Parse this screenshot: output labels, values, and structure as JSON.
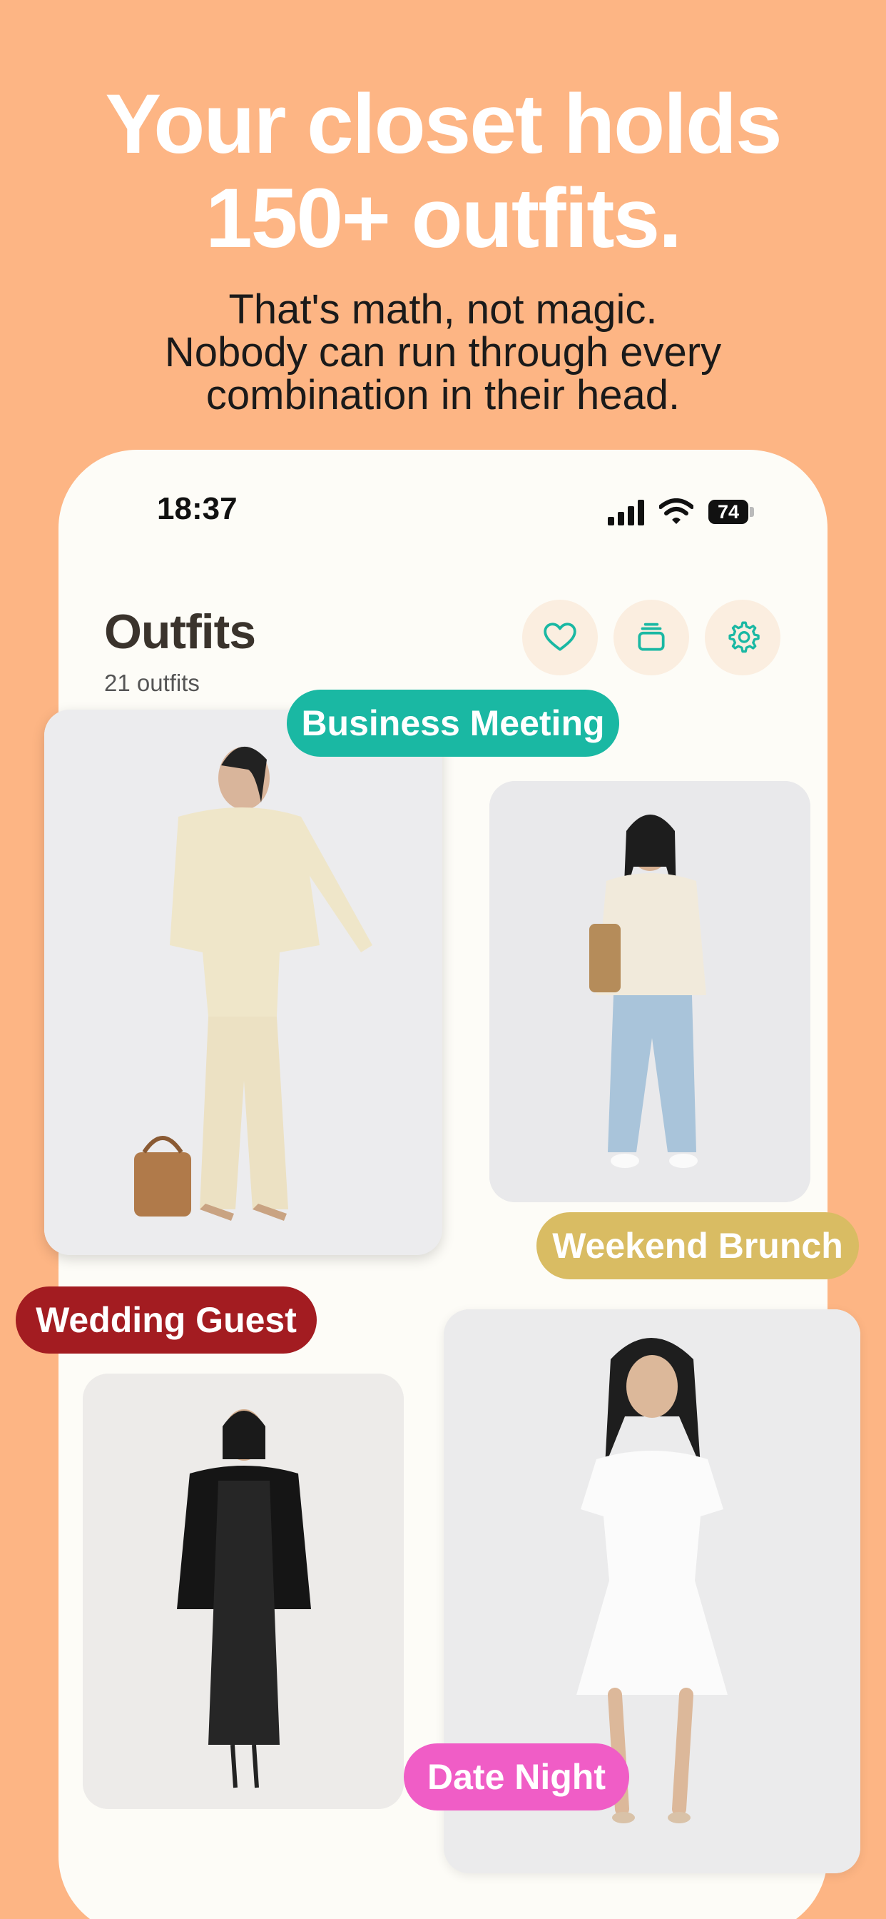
{
  "headline": {
    "line1": "Your closet holds",
    "line2": "150+ outfits."
  },
  "subtitle": {
    "line1": "That's math, not magic.",
    "line2": "Nobody can run through every",
    "line3": "combination in their head."
  },
  "status_bar": {
    "time": "18:37",
    "battery": "74"
  },
  "header": {
    "title": "Outfits",
    "count": "21 outfits"
  },
  "actions": [
    {
      "icon": "heart-icon"
    },
    {
      "icon": "stack-icon"
    },
    {
      "icon": "gear-icon"
    }
  ],
  "outfits": [
    {
      "tag": "Business Meeting",
      "tag_color": "#1AB8A3"
    },
    {
      "tag": "Weekend Brunch",
      "tag_color": "#D9BC63"
    },
    {
      "tag": "Wedding Guest",
      "tag_color": "#A31C21"
    },
    {
      "tag": "Date Night",
      "tag_color": "#F05DC6"
    }
  ],
  "colors": {
    "background": "#FDB584",
    "accent": "#1AB8A3",
    "panel": "#FDFCF7"
  }
}
